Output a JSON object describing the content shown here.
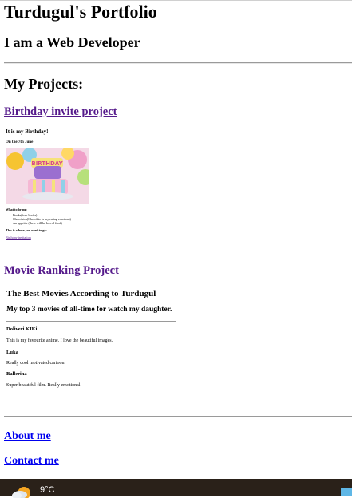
{
  "header": {
    "title": "Turdugul's Portfolio",
    "subtitle": "I am a Web Developer"
  },
  "projects": {
    "heading": "My Projects:",
    "birthday": {
      "link_label": "Birthday invite project",
      "preview": {
        "title": "It is my Birthday!",
        "date": "On the 7th June",
        "what_to_bring": "What to bring:",
        "items": [
          "Books(love books)",
          "Chocolates(Chocolate is my eating emotions)",
          "An appetite (there will be lots of food)"
        ],
        "where": "This is where you need to go:",
        "map_link": "Birthday invitation"
      }
    },
    "movie": {
      "link_label": "Movie Ranking Project",
      "preview": {
        "title": "The Best Movies According to Turdugul",
        "subtitle": "My top 3 movies of all-time for watch my daughter.",
        "movies": [
          {
            "name": "Doliveri KIKi",
            "description": "This is my favourite anime. I love the beautiful images."
          },
          {
            "name": "Luka",
            "description": "Really cool motivated cartoon."
          },
          {
            "name": "Ballerina",
            "description": "Super beautiful film. Really emotional."
          }
        ]
      }
    }
  },
  "nav": {
    "about": "About me",
    "contact": "Contact me"
  },
  "taskbar": {
    "temperature": "9°C",
    "weather_icon": "partly-cloudy-icon"
  },
  "colors": {
    "visited_link": "#551a8b",
    "link": "#0000ee",
    "taskbar_bg": "#2a2119"
  }
}
